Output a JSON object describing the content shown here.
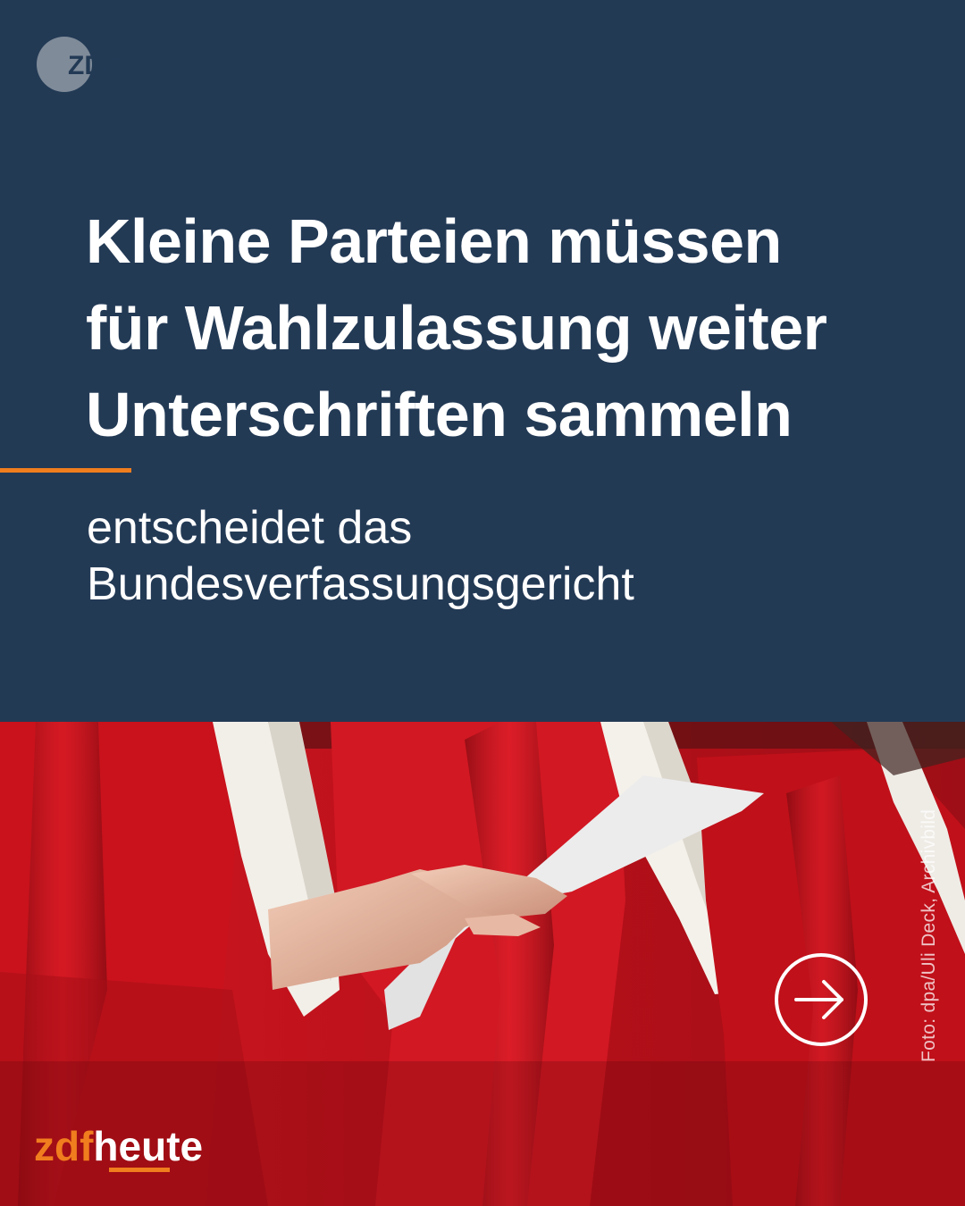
{
  "logo": {
    "name": "zdf-logo",
    "text": "ZDF"
  },
  "headline": {
    "lines": [
      "Kleine Parteien müssen",
      "für Wahlzulassung weiter",
      "Unterschriften sammeln"
    ]
  },
  "subline": {
    "lines": [
      "entscheidet das",
      "Bundesverfassungsgericht"
    ]
  },
  "photo": {
    "credit": "Foto: dpa/Uli Deck, Archivbild"
  },
  "next_button": {
    "icon": "arrow-right-circle-icon"
  },
  "brand": {
    "part1": "zdf",
    "part2": "heute"
  },
  "colors": {
    "background": "#233a55",
    "accent": "#f07d1e",
    "text": "#ffffff",
    "robe_red": "#c8141e"
  }
}
